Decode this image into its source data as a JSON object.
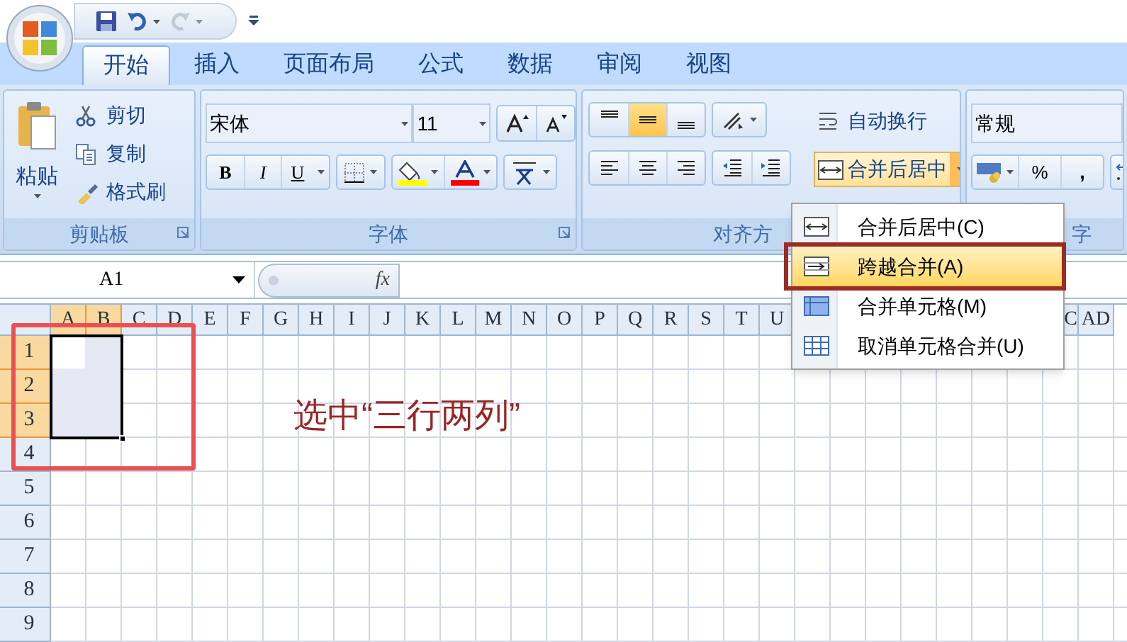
{
  "quick_access": [
    {
      "kind": "save",
      "disabled": false
    },
    {
      "kind": "undo",
      "disabled": false
    },
    {
      "kind": "redo",
      "disabled": true
    }
  ],
  "tabs": [
    {
      "label": "开始",
      "selected": true
    },
    {
      "label": "插入",
      "selected": false
    },
    {
      "label": "页面布局",
      "selected": false
    },
    {
      "label": "公式",
      "selected": false
    },
    {
      "label": "数据",
      "selected": false
    },
    {
      "label": "审阅",
      "selected": false
    },
    {
      "label": "视图",
      "selected": false
    }
  ],
  "ribbon": {
    "clipboard": {
      "label": "剪贴板",
      "paste": "粘贴",
      "items": [
        {
          "kind": "cut",
          "label": "剪切"
        },
        {
          "kind": "copy",
          "label": "复制"
        },
        {
          "kind": "brush",
          "label": "格式刷"
        }
      ]
    },
    "font": {
      "label": "字体",
      "font_name": "宋体",
      "font_size": "11",
      "bold": "B",
      "italic": "I",
      "underline": "U"
    },
    "alignment": {
      "label": "对齐方",
      "vertical_align": [
        {
          "selected": false
        },
        {
          "selected": true
        },
        {
          "selected": false
        }
      ],
      "wrap_text": "自动换行",
      "merge_button": {
        "label": "合并后居中",
        "open": true
      }
    },
    "number": {
      "label": "字",
      "format": "常规",
      "percent": "%",
      "comma": ","
    }
  },
  "merge_menu": [
    {
      "kind": "center",
      "label": "合并后居中(C)",
      "selected": false
    },
    {
      "kind": "across",
      "label": "跨越合并(A)",
      "selected": true
    },
    {
      "kind": "merge",
      "label": "合并单元格(M)",
      "selected": false
    },
    {
      "kind": "unmerge",
      "label": "取消单元格合并(U)",
      "selected": false
    }
  ],
  "formula_bar": {
    "name_box": "A1",
    "function_label": "fx"
  },
  "sheet": {
    "columns": [
      {
        "label": "A",
        "selected": true
      },
      {
        "label": "B",
        "selected": true
      },
      {
        "label": "C",
        "selected": false
      },
      {
        "label": "D",
        "selected": false
      },
      {
        "label": "E",
        "selected": false
      },
      {
        "label": "F",
        "selected": false
      },
      {
        "label": "G",
        "selected": false
      },
      {
        "label": "H",
        "selected": false
      },
      {
        "label": "I",
        "selected": false
      },
      {
        "label": "J",
        "selected": false
      },
      {
        "label": "K",
        "selected": false
      },
      {
        "label": "L",
        "selected": false
      },
      {
        "label": "M",
        "selected": false
      },
      {
        "label": "N",
        "selected": false
      },
      {
        "label": "O",
        "selected": false
      },
      {
        "label": "P",
        "selected": false
      },
      {
        "label": "Q",
        "selected": false
      },
      {
        "label": "R",
        "selected": false
      },
      {
        "label": "S",
        "selected": false
      },
      {
        "label": "T",
        "selected": false
      },
      {
        "label": "U",
        "selected": false
      },
      {
        "label": "C",
        "selected": false
      },
      {
        "label": "AD",
        "selected": false
      }
    ],
    "rows": [
      {
        "label": "1",
        "selected": true
      },
      {
        "label": "2",
        "selected": true
      },
      {
        "label": "3",
        "selected": true
      },
      {
        "label": "4",
        "selected": false
      },
      {
        "label": "5",
        "selected": false
      },
      {
        "label": "6",
        "selected": false
      },
      {
        "label": "7",
        "selected": false
      },
      {
        "label": "8",
        "selected": false
      },
      {
        "label": "9",
        "selected": false
      }
    ]
  },
  "annotation": {
    "text": "选中“三行两列”"
  }
}
